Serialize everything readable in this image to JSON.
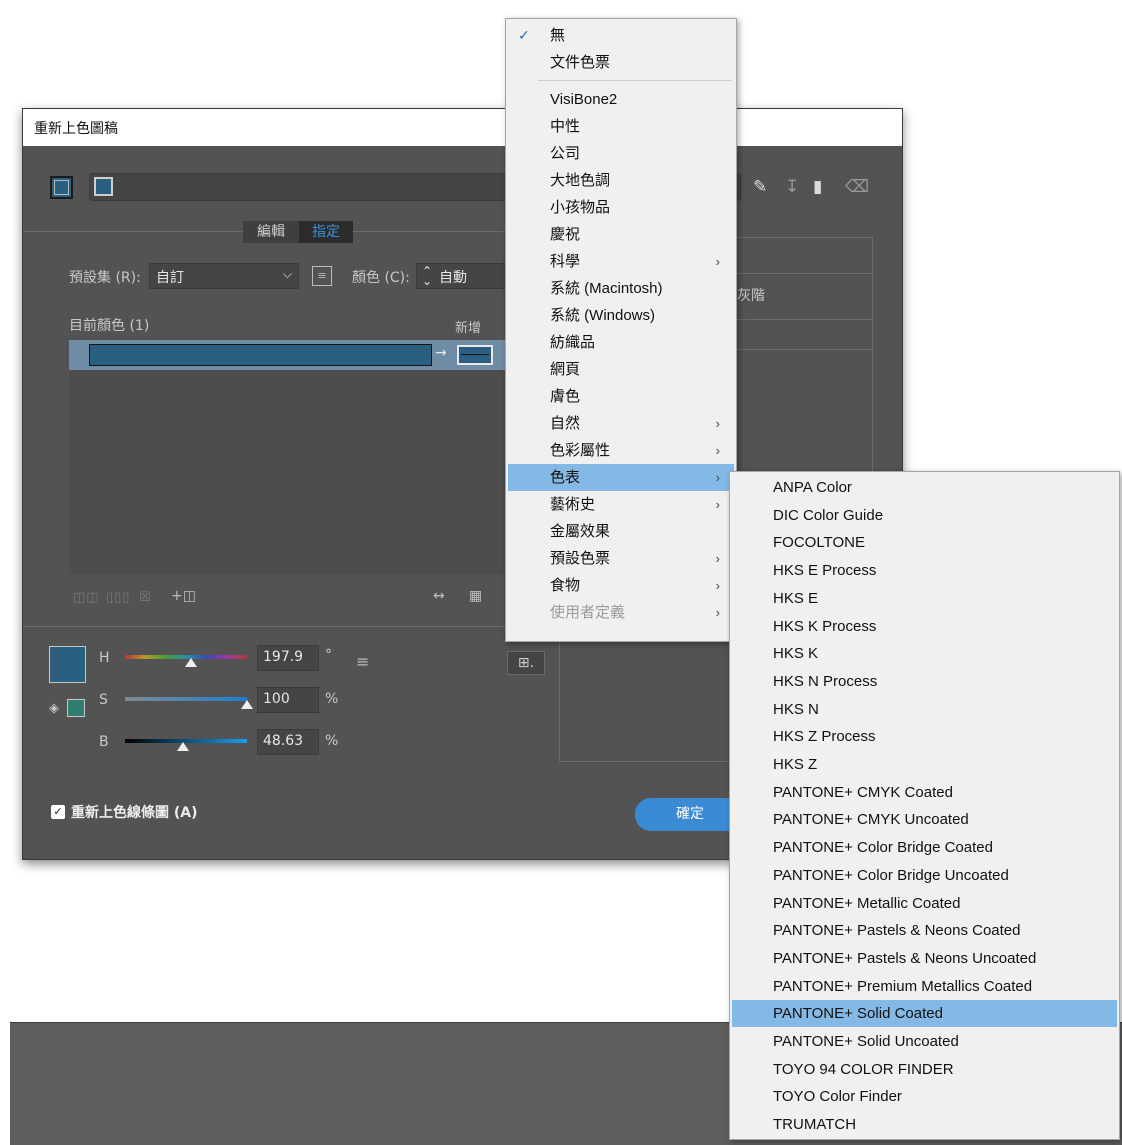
{
  "dialog": {
    "title": "重新上色圖稿",
    "tabs": {
      "edit": "編輯",
      "assign": "指定"
    },
    "preset_label": "預設集 (R):",
    "preset_value": "自訂",
    "colors_label": "顏色 (C):",
    "colors_value": "自動",
    "current_colors_label": "目前顏色 (1)",
    "new_label": "新增",
    "arrow": "→",
    "partial_column_text": "灰階",
    "hsb": {
      "h_label": "H",
      "h_value": "197.9",
      "h_unit": "°",
      "s_label": "S",
      "s_value": "100",
      "s_unit": "%",
      "b_label": "B",
      "b_value": "48.63",
      "b_unit": "%"
    },
    "recolor_art_label": "重新上色線條圖 (A)",
    "ok_label": "確定",
    "current_color": "#2b5f82"
  },
  "library_menu": {
    "items": [
      {
        "label": "無",
        "checked": true
      },
      {
        "label": "文件色票"
      },
      {
        "label": "VisiBone2"
      },
      {
        "label": "中性"
      },
      {
        "label": "公司"
      },
      {
        "label": "大地色調"
      },
      {
        "label": "小孩物品"
      },
      {
        "label": "慶祝"
      },
      {
        "label": "科學"
      },
      {
        "label": "系統 (Macintosh)"
      },
      {
        "label": "系統 (Windows)"
      },
      {
        "label": "紡織品"
      },
      {
        "label": "網頁"
      },
      {
        "label": "膚色"
      },
      {
        "label": "自然"
      },
      {
        "label": "色彩屬性"
      },
      {
        "label": "色表"
      },
      {
        "label": "藝術史"
      },
      {
        "label": "金屬效果"
      },
      {
        "label": "預設色票"
      },
      {
        "label": "食物"
      },
      {
        "label": "使用者定義"
      }
    ],
    "submenu_arrow": "›"
  },
  "color_books_submenu": {
    "items": [
      "ANPA Color",
      "DIC Color Guide",
      "FOCOLTONE",
      "HKS E Process",
      "HKS E",
      "HKS K Process",
      "HKS K",
      "HKS N Process",
      "HKS N",
      "HKS Z Process",
      "HKS Z",
      "PANTONE+ CMYK Coated",
      "PANTONE+ CMYK Uncoated",
      "PANTONE+ Color Bridge Coated",
      "PANTONE+ Color Bridge Uncoated",
      "PANTONE+ Metallic Coated",
      "PANTONE+ Pastels & Neons Coated",
      "PANTONE+ Pastels & Neons Uncoated",
      "PANTONE+ Premium Metallics Coated",
      "PANTONE+ Solid Coated",
      "PANTONE+ Solid Uncoated",
      "TOYO 94 COLOR FINDER",
      "TOYO Color Finder",
      "TRUMATCH"
    ]
  }
}
